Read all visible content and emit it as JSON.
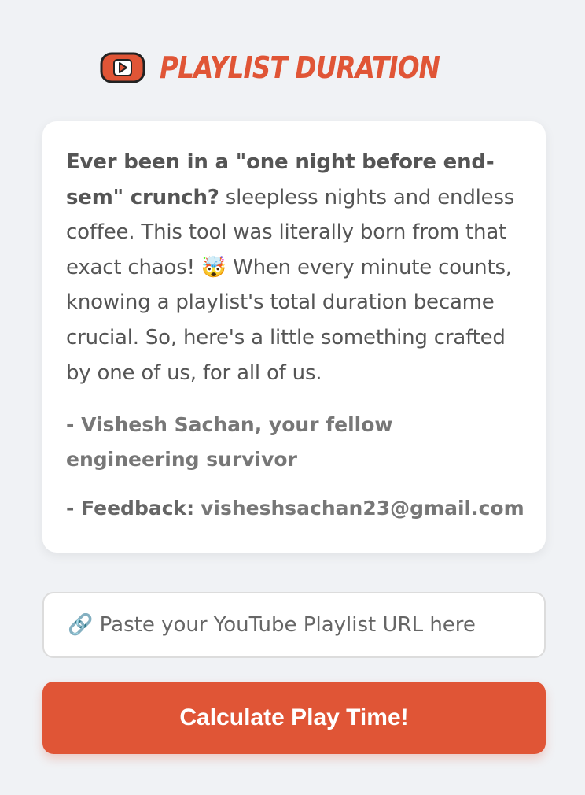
{
  "header": {
    "logo_icon": "youtube-play-icon",
    "title": "Playlist Duration"
  },
  "card": {
    "intro_bold": "Ever been in a \"one night before end-sem\" crunch?",
    "intro_text": " sleepless nights and endless coffee. This tool was literally born from that exact chaos! 🤯 When every minute counts, knowing a playlist's total duration became crucial. So, here's a little something crafted by one of us, for all of us.",
    "author": "- Vishesh Sachan, your fellow engineering survivor",
    "feedback_label": "- Feedback:",
    "feedback_email": "visheshsachan23@gmail.com"
  },
  "form": {
    "url_placeholder": "🔗 Paste your YouTube Playlist URL here",
    "url_value": "",
    "submit_label": "Calculate Play Time!"
  },
  "colors": {
    "accent": "#e05536",
    "background": "#f0f2f5",
    "card": "#ffffff"
  }
}
